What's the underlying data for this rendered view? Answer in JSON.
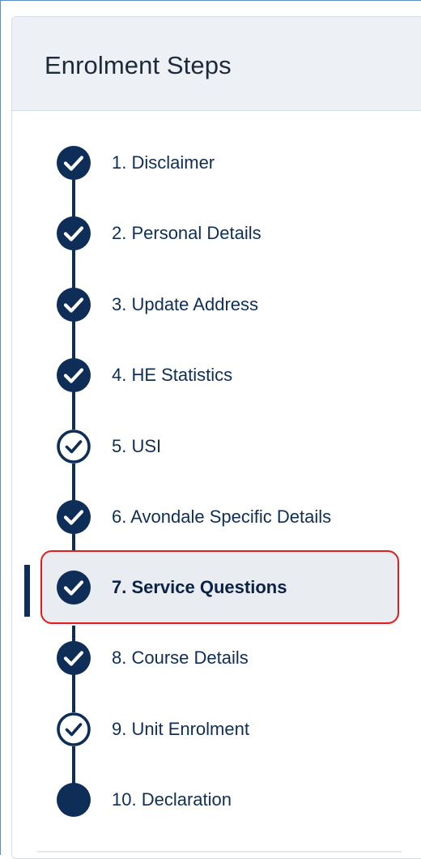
{
  "panel": {
    "title": "Enrolment Steps"
  },
  "colors": {
    "primary": "#0f2e57",
    "highlight_border": "#e11d1d",
    "active_bg": "#e9ecf1",
    "header_bg": "#edf0f4"
  },
  "steps": [
    {
      "label": "1. Disclaimer",
      "status": "complete",
      "icon": "check-circle-filled-icon"
    },
    {
      "label": "2. Personal Details",
      "status": "complete",
      "icon": "check-circle-filled-icon"
    },
    {
      "label": "3. Update Address",
      "status": "complete",
      "icon": "check-circle-filled-icon"
    },
    {
      "label": "4. HE Statistics",
      "status": "complete",
      "icon": "check-circle-filled-icon"
    },
    {
      "label": "5. USI",
      "status": "optional-complete",
      "icon": "check-circle-outline-icon"
    },
    {
      "label": "6. Avondale Specific Details",
      "status": "complete",
      "icon": "check-circle-filled-icon"
    },
    {
      "label": "7. Service Questions",
      "status": "active",
      "icon": "check-circle-filled-icon"
    },
    {
      "label": "8. Course Details",
      "status": "complete",
      "icon": "check-circle-filled-icon"
    },
    {
      "label": "9. Unit Enrolment",
      "status": "optional-complete",
      "icon": "check-circle-outline-icon"
    },
    {
      "label": "10. Declaration",
      "status": "pending",
      "icon": "filled-circle-icon"
    }
  ]
}
